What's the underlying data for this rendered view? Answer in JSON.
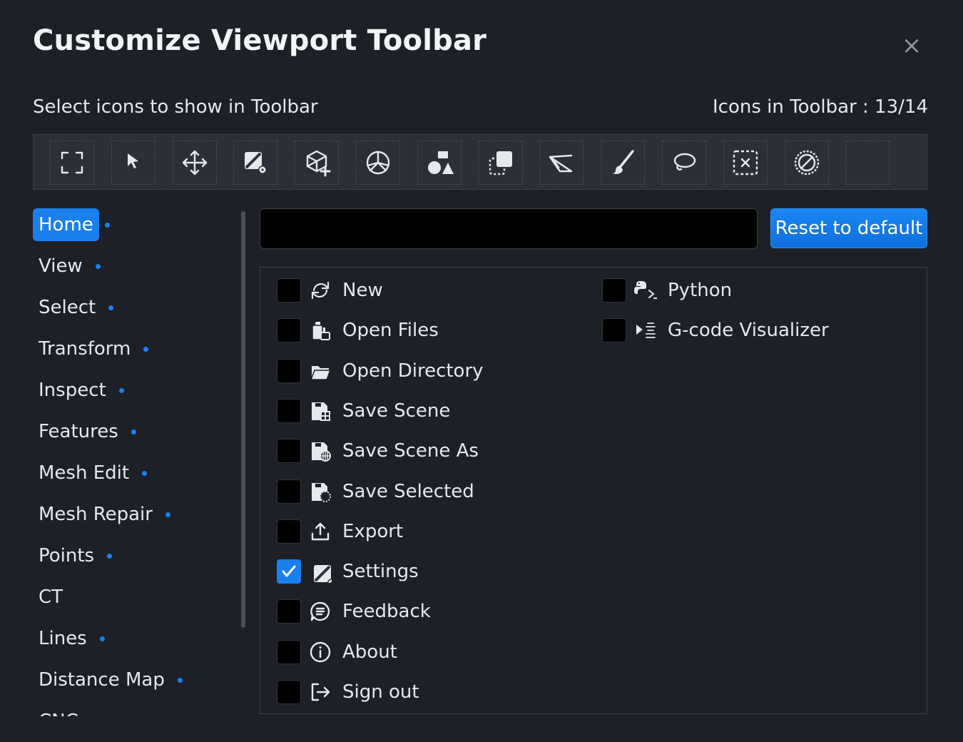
{
  "dialog": {
    "title": "Customize Viewport Toolbar",
    "close_icon": "×",
    "subtitle": "Select icons to show in Toolbar",
    "icon_count": "Icons in Toolbar : 13/14"
  },
  "toolbar": {
    "slots": [
      {
        "icon": "fit-view-icon"
      },
      {
        "icon": "pointer-icon"
      },
      {
        "icon": "move-icon"
      },
      {
        "icon": "settings-icon"
      },
      {
        "icon": "add-mesh-icon"
      },
      {
        "icon": "peace-icon"
      },
      {
        "icon": "shapes-icon"
      },
      {
        "icon": "duplicate-icon"
      },
      {
        "icon": "plane-cut-icon"
      },
      {
        "icon": "brush-icon"
      },
      {
        "icon": "lasso-icon"
      },
      {
        "icon": "clear-selection-icon"
      },
      {
        "icon": "disable-icon"
      },
      {
        "icon": "empty-slot"
      }
    ]
  },
  "categories": [
    {
      "label": "Home",
      "active": true,
      "dot": true
    },
    {
      "label": "View",
      "dot": true
    },
    {
      "label": "Select",
      "dot": true
    },
    {
      "label": "Transform",
      "dot": true
    },
    {
      "label": "Inspect",
      "dot": true
    },
    {
      "label": "Features",
      "dot": true
    },
    {
      "label": "Mesh Edit",
      "dot": true
    },
    {
      "label": "Mesh Repair",
      "dot": true
    },
    {
      "label": "Points",
      "dot": true
    },
    {
      "label": "CT",
      "dot": false
    },
    {
      "label": "Lines",
      "dot": true
    },
    {
      "label": "Distance Map",
      "dot": true
    },
    {
      "label": "CNC",
      "dot": false
    }
  ],
  "search": {
    "value": "",
    "placeholder": ""
  },
  "reset_label": "Reset to default",
  "items_col1": [
    {
      "label": "New",
      "icon": "refresh-icon",
      "checked": false
    },
    {
      "label": "Open Files",
      "icon": "open-files-icon",
      "checked": false
    },
    {
      "label": "Open Directory",
      "icon": "folder-open-icon",
      "checked": false
    },
    {
      "label": "Save Scene",
      "icon": "save-scene-icon",
      "checked": false
    },
    {
      "label": "Save Scene As",
      "icon": "save-scene-as-icon",
      "checked": false
    },
    {
      "label": "Save Selected",
      "icon": "save-selected-icon",
      "checked": false
    },
    {
      "label": "Export",
      "icon": "export-icon",
      "checked": false
    },
    {
      "label": "Settings",
      "icon": "settings-icon",
      "checked": true
    },
    {
      "label": "Feedback",
      "icon": "feedback-icon",
      "checked": false
    },
    {
      "label": "About",
      "icon": "info-icon",
      "checked": false
    },
    {
      "label": "Sign out",
      "icon": "sign-out-icon",
      "checked": false
    }
  ],
  "items_col2": [
    {
      "label": "Python",
      "icon": "python-icon",
      "checked": false
    },
    {
      "label": "G-code Visualizer",
      "icon": "gcode-icon",
      "checked": false
    }
  ],
  "colors": {
    "accent": "#1a80f0",
    "background": "#1d2027",
    "panel": "#2b2f37"
  }
}
